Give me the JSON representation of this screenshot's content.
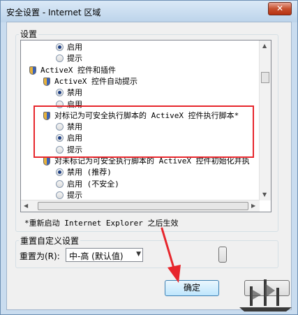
{
  "window": {
    "title": "安全设置 - Internet 区域",
    "close_glyph": "✕"
  },
  "settings_group": {
    "label": "设置"
  },
  "tree": {
    "rows": [
      {
        "kind": "radio",
        "checked": true,
        "label": "启用"
      },
      {
        "kind": "radio",
        "checked": false,
        "label": "提示"
      },
      {
        "kind": "category",
        "label": "ActiveX 控件和插件"
      },
      {
        "kind": "setting",
        "label": "ActiveX 控件自动提示"
      },
      {
        "kind": "radio",
        "checked": true,
        "label": "禁用"
      },
      {
        "kind": "radio",
        "checked": false,
        "label": "启用"
      },
      {
        "kind": "setting",
        "label": "对标记为可安全执行脚本的 ActiveX 控件执行脚本*"
      },
      {
        "kind": "radio",
        "checked": false,
        "label": "禁用"
      },
      {
        "kind": "radio",
        "checked": true,
        "label": "启用"
      },
      {
        "kind": "radio",
        "checked": false,
        "label": "提示"
      },
      {
        "kind": "setting",
        "label": "对未标记为可安全执行脚本的 ActiveX 控件初始化并执"
      },
      {
        "kind": "radio",
        "checked": true,
        "label": "禁用 (推荐)"
      },
      {
        "kind": "radio",
        "checked": false,
        "label": "启用 (不安全)"
      },
      {
        "kind": "radio",
        "checked": false,
        "label": "提示"
      }
    ]
  },
  "restart_note": "*重新启动 Internet Explorer 之后生效",
  "reset_group": {
    "label": "重置自定义设置",
    "reset_to_label": "重置为(R):",
    "selected_level": "中-高 (默认值)"
  },
  "buttons": {
    "ok": "确定"
  },
  "colors": {
    "highlight": "#e7262c",
    "pointer": "#e7262c"
  }
}
